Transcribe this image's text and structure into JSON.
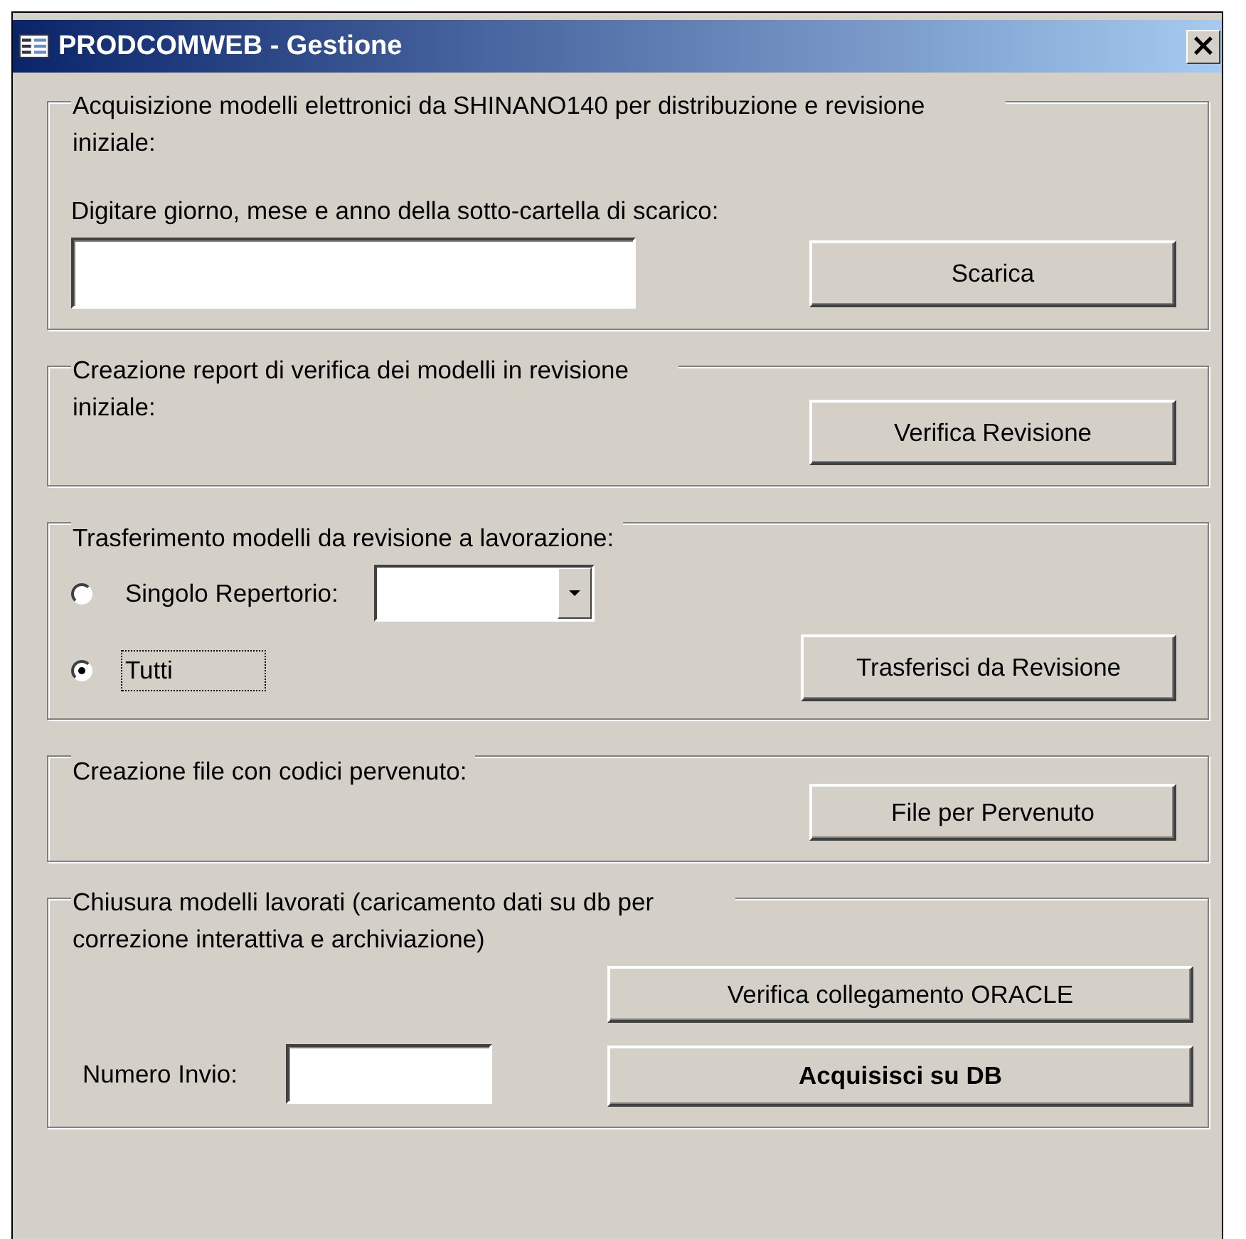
{
  "window": {
    "title": "PRODCOMWEB - Gestione",
    "close": "×"
  },
  "sections": [
    {
      "kind": "download",
      "title": "Acquisizione modelli elettronici da SHINANO140 per distribuzione e revisione iniziale:",
      "prompt": "Digitare giorno, mese e anno della sotto-cartella di scarico:",
      "button": {
        "label": "Scarica",
        "bold": false
      }
    },
    {
      "kind": "action",
      "title": "Creazione report di verifica dei modelli in revisione iniziale:",
      "button": {
        "label": "Verifica Revisione",
        "bold": false
      }
    },
    {
      "kind": "transfer",
      "title": "Trasferimento modelli da revisione a lavorazione:",
      "options": [
        {
          "label": "Singolo Repertorio:",
          "selected": false,
          "focused": false,
          "kind": "combo"
        },
        {
          "label": "Tutti",
          "selected": true,
          "focused": true,
          "kind": "plain"
        }
      ],
      "button": {
        "label": "Trasferisci da Revisione",
        "bold": false
      }
    },
    {
      "kind": "action",
      "title": "Creazione file con codici pervenuto:",
      "button": {
        "label": "File per Pervenuto",
        "bold": false
      }
    },
    {
      "kind": "close",
      "title": "Chiusura modelli lavorati (caricamento dati su db per correzione interattiva e archiviazione)",
      "field_label": "Numero Invio:",
      "buttons": [
        {
          "label": "Verifica collegamento ORACLE",
          "bold": false
        },
        {
          "label": "Acquisisci su DB",
          "bold": true
        }
      ]
    }
  ]
}
